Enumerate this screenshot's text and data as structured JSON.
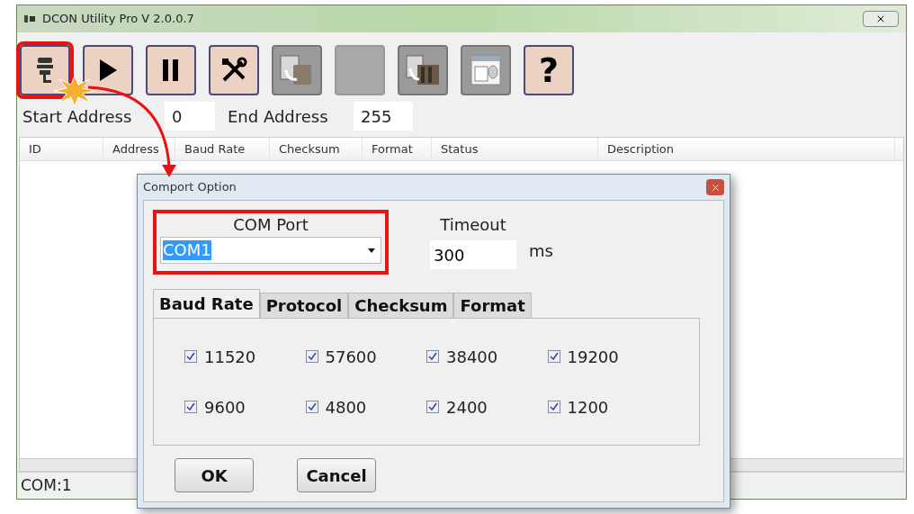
{
  "window": {
    "title": "DCON Utility Pro V 2.0.0.7"
  },
  "toolbar": [
    {
      "kind": "connect",
      "highlighted": true
    },
    {
      "kind": "play",
      "highlighted": false
    },
    {
      "kind": "pause",
      "highlighted": false
    },
    {
      "kind": "tools",
      "highlighted": false
    },
    {
      "kind": "module",
      "highlighted": false
    },
    {
      "kind": "blank",
      "highlighted": false
    },
    {
      "kind": "rack",
      "highlighted": false
    },
    {
      "kind": "document",
      "highlighted": false
    },
    {
      "kind": "help",
      "label": "?",
      "highlighted": false
    }
  ],
  "address": {
    "start_label": "Start Address",
    "start_value": "0",
    "end_label": "End Address",
    "end_value": "255"
  },
  "table": {
    "columns": [
      "ID",
      "Address",
      "Baud Rate",
      "Checksum",
      "Format",
      "Status",
      "Description"
    ]
  },
  "status_bar": "COM:1",
  "dialog": {
    "title": "Comport Option",
    "com_port": {
      "label": "COM Port",
      "value": "COM1",
      "highlighted": true
    },
    "timeout": {
      "label": "Timeout",
      "value": "300",
      "unit": "ms"
    },
    "tabs": [
      {
        "label": "Baud Rate",
        "selected": true
      },
      {
        "label": "Protocol",
        "selected": false
      },
      {
        "label": "Checksum",
        "selected": false
      },
      {
        "label": "Format",
        "selected": false
      }
    ],
    "baud_rates": [
      {
        "label": "11520",
        "checked": true
      },
      {
        "label": "57600",
        "checked": true
      },
      {
        "label": "38400",
        "checked": true
      },
      {
        "label": "19200",
        "checked": true
      },
      {
        "label": "9600",
        "checked": true
      },
      {
        "label": "4800",
        "checked": true
      },
      {
        "label": "2400",
        "checked": true
      },
      {
        "label": "1200",
        "checked": true
      }
    ],
    "buttons": [
      "OK",
      "Cancel"
    ]
  }
}
